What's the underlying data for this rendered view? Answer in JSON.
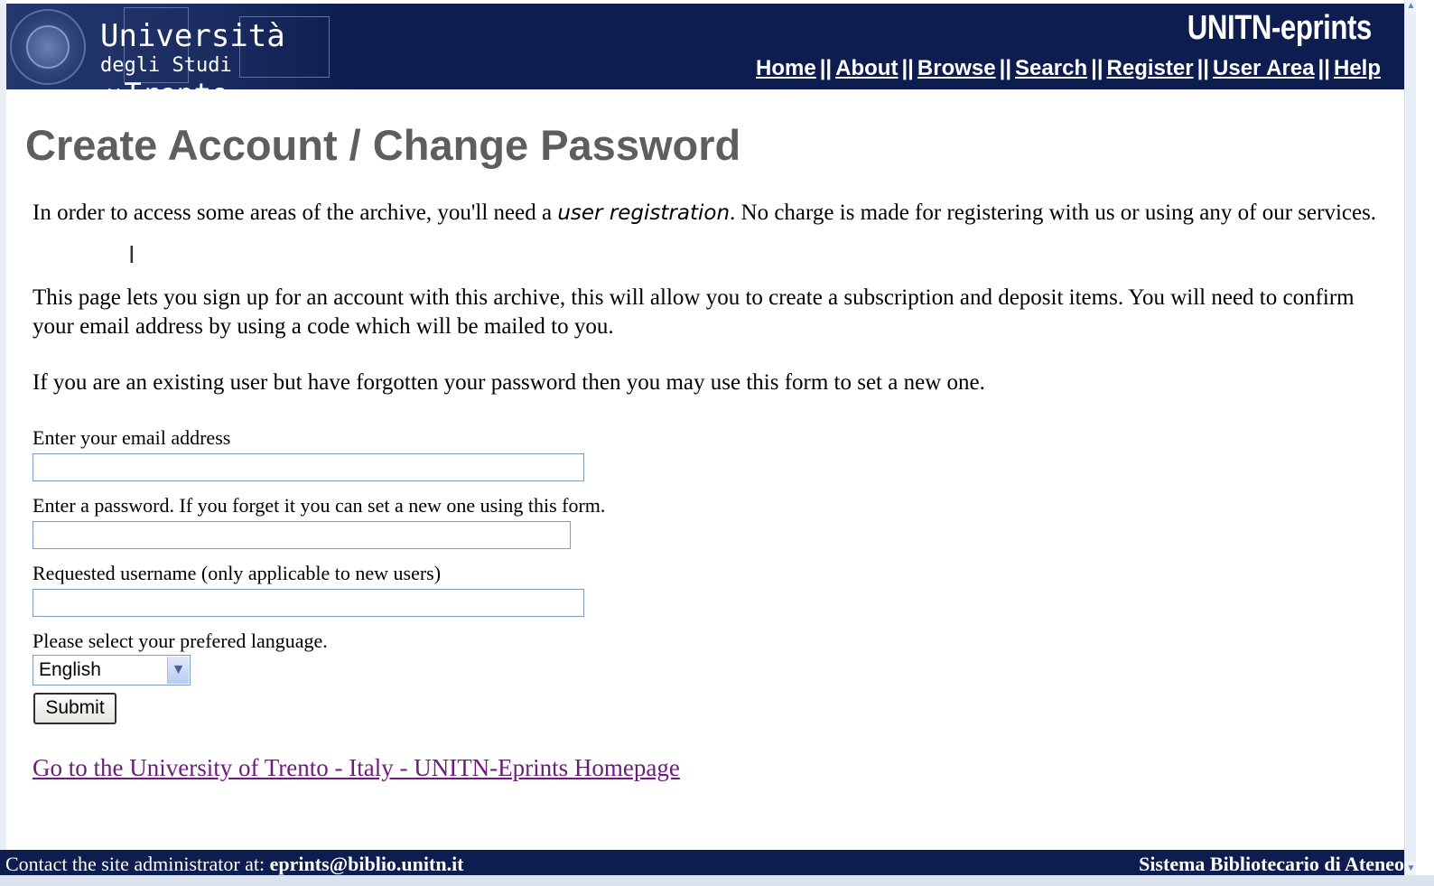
{
  "header": {
    "logo_line1": "Università",
    "logo_line2_small": "degli Studi di",
    "logo_line2_big": "Trento",
    "site_title": "UNITN-eprints",
    "nav": [
      {
        "label": "Home"
      },
      {
        "label": "About"
      },
      {
        "label": "Browse"
      },
      {
        "label": "Search"
      },
      {
        "label": "Register"
      },
      {
        "label": "User Area"
      },
      {
        "label": "Help"
      }
    ],
    "nav_separator": "||"
  },
  "main": {
    "page_title": "Create Account / Change Password",
    "intro_part1": "In order to access some areas of the archive, you'll need a ",
    "intro_emphasis": "user registration",
    "intro_part2": ". No charge is made for registering with us or using any of our services.",
    "signup_text": "This page lets you sign up for an account with this archive, this will allow you to create a subscription and deposit items. You will need to confirm your email address by using a code which will be mailed to you.",
    "forgot_text": "If you are an existing user but have forgotten your password then you may use this form to set a new one.",
    "form": {
      "email_label": "Enter your email address",
      "email_value": "",
      "password_label": "Enter a password. If you forget it you can set a new one using this form.",
      "password_value": "",
      "username_label": "Requested username (only applicable to new users)",
      "username_value": "",
      "language_label": "Please select your prefered language.",
      "language_selected": "English",
      "submit_label": "Submit"
    },
    "home_link": "Go to the University of Trento - Italy - UNITN-Eprints Homepage"
  },
  "footer": {
    "contact_prefix": "Contact the site administrator at: ",
    "contact_email": "eprints@biblio.unitn.it",
    "right_text": "Sistema Bibliotecario di Ateneo"
  },
  "icons": {
    "cursor": "text-cursor-icon",
    "seal": "university-seal-icon",
    "select_arrow": "chevron-down-icon"
  }
}
